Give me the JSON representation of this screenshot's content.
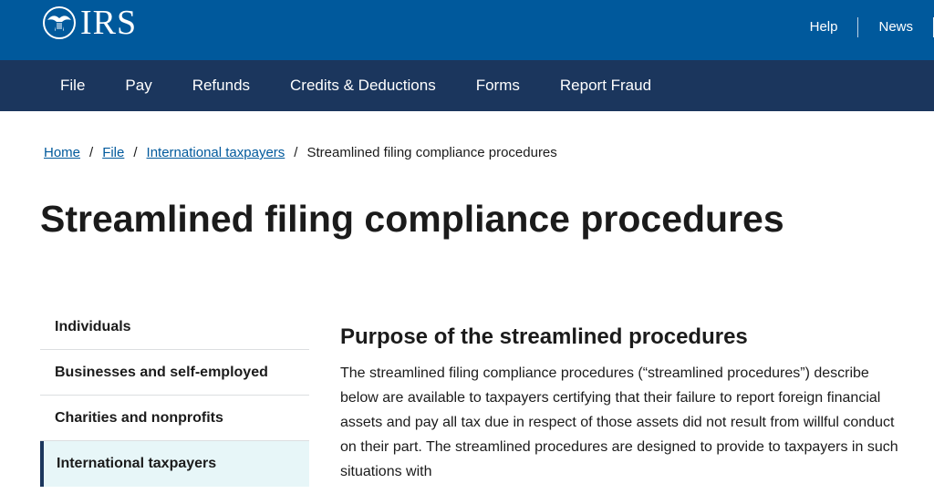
{
  "header": {
    "logo_text": "IRS",
    "utility_links": [
      "Help",
      "News"
    ]
  },
  "main_nav": {
    "items": [
      "File",
      "Pay",
      "Refunds",
      "Credits & Deductions",
      "Forms",
      "Report Fraud"
    ]
  },
  "breadcrumb": {
    "links": [
      "Home",
      "File",
      "International taxpayers"
    ],
    "separator": "/",
    "current": "Streamlined filing compliance procedures"
  },
  "page": {
    "title": "Streamlined filing compliance procedures"
  },
  "sidenav": {
    "items": [
      "Individuals",
      "Businesses and self-employed",
      "Charities and nonprofits",
      "International taxpayers"
    ],
    "active_index": 3
  },
  "content": {
    "heading": "Purpose of the streamlined procedures",
    "paragraph": "The streamlined filing compliance procedures (“streamlined procedures”) describe below are available to taxpayers certifying that their failure to report foreign financial assets and pay all tax due in respect of those assets did not result from willful conduct on their part. The streamlined procedures are designed to provide to taxpayers in such situations with"
  },
  "colors": {
    "top_bar": "#00599c",
    "main_nav": "#1b365d",
    "link": "#00599c",
    "active_sidenav_bg": "#e7f6f8"
  },
  "icons": {
    "logo": "irs-eagle-logo-icon"
  }
}
